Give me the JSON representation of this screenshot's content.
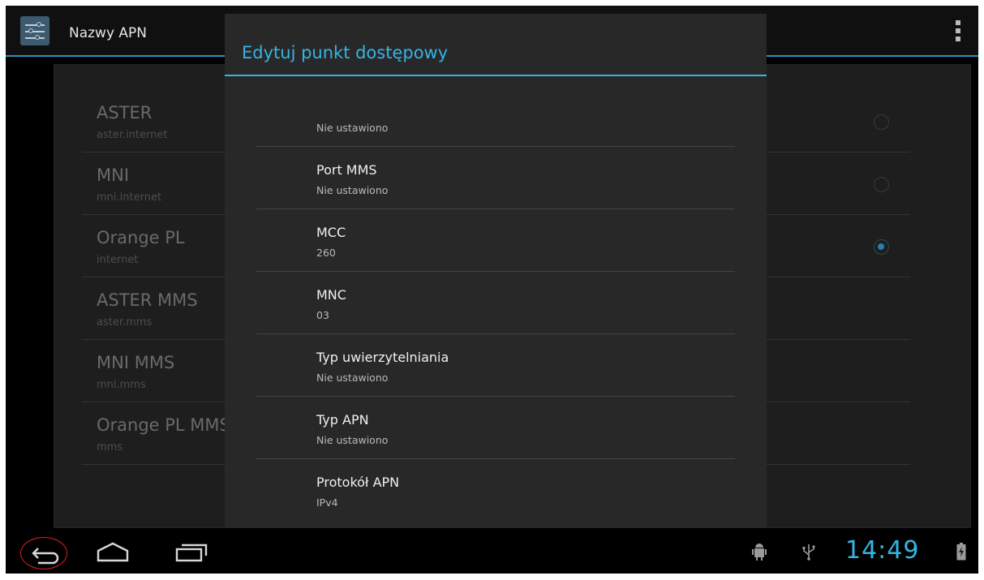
{
  "action_bar": {
    "title": "Nazwy APN"
  },
  "apn_list": [
    {
      "name": "ASTER",
      "apn": "aster.internet",
      "selectable": true,
      "selected": false
    },
    {
      "name": "MNI",
      "apn": "mni.internet",
      "selectable": true,
      "selected": false
    },
    {
      "name": "Orange PL",
      "apn": "internet",
      "selectable": true,
      "selected": true
    },
    {
      "name": "ASTER MMS",
      "apn": "aster.mms",
      "selectable": false,
      "selected": false
    },
    {
      "name": "MNI MMS",
      "apn": "mni.mms",
      "selectable": false,
      "selected": false
    },
    {
      "name": "Orange PL MMS",
      "apn": "mms",
      "selectable": false,
      "selected": false
    }
  ],
  "dialog": {
    "title": "Edytuj punkt dostępowy",
    "items": [
      {
        "title": "",
        "summary": "Nie ustawiono"
      },
      {
        "title": "Port MMS",
        "summary": "Nie ustawiono"
      },
      {
        "title": "MCC",
        "summary": "260"
      },
      {
        "title": "MNC",
        "summary": "03"
      },
      {
        "title": "Typ uwierzytelniania",
        "summary": "Nie ustawiono"
      },
      {
        "title": "Typ APN",
        "summary": "Nie ustawiono"
      },
      {
        "title": "Protokół APN",
        "summary": "IPv4"
      }
    ]
  },
  "status_bar": {
    "time": "14:49"
  },
  "colors": {
    "accent": "#33b5e5",
    "highlight_circle": "#e02020"
  },
  "icons": [
    "settings-sliders-icon",
    "overflow-menu-icon",
    "back-icon",
    "home-icon",
    "recent-apps-icon",
    "android-debug-icon",
    "usb-icon",
    "battery-charging-icon"
  ]
}
